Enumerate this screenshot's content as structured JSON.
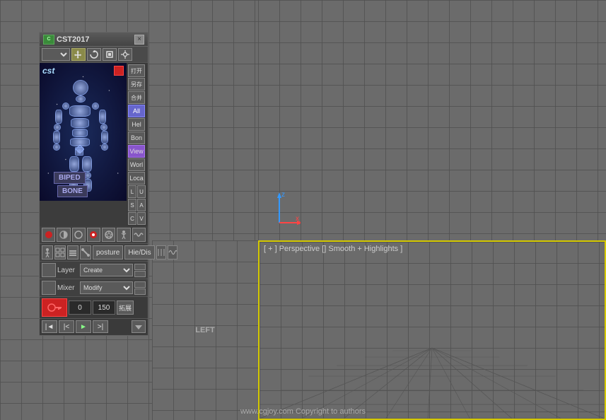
{
  "app": {
    "title": "CST2017",
    "copyright": "www.cgjoy.com  Copyright to authors"
  },
  "panel": {
    "title": "CST2017",
    "close_label": "×",
    "toolbar": {
      "dropdown_value": "",
      "buttons": [
        "move",
        "rotate",
        "scale",
        "settings"
      ]
    },
    "right_buttons": [
      {
        "label": "打开",
        "selected": false
      },
      {
        "label": "另存",
        "selected": false
      },
      {
        "label": "合并",
        "selected": false
      },
      {
        "label": "All",
        "selected": true
      },
      {
        "label": "Hel",
        "selected": false
      },
      {
        "label": "Bon",
        "selected": false
      },
      {
        "label": "View",
        "selected": true,
        "highlighted": true
      },
      {
        "label": "Worl",
        "selected": false
      },
      {
        "label": "Loca",
        "selected": false
      },
      {
        "label": "L",
        "selected": false
      },
      {
        "label": "U",
        "selected": false
      },
      {
        "label": "S",
        "selected": false
      },
      {
        "label": "A",
        "selected": false
      },
      {
        "label": "C",
        "selected": false
      },
      {
        "label": "V",
        "selected": false
      }
    ],
    "biped_label": "BIPED",
    "bone_label": "BONE",
    "ctrl_buttons": [
      "●",
      "◐",
      "◑",
      "◒",
      "☆"
    ],
    "posture_btn": "posture",
    "hie_dis_btn": "Hie/Dis",
    "layer_label": "Layer",
    "layer_create": "Create",
    "mixer_label": "Mixer",
    "mixer_modify": "Modify",
    "key_frame_value": "0",
    "frame_end_value": "150",
    "expand_label": "拓展",
    "playback_controls": [
      "|◄",
      "|<",
      "►",
      ">|"
    ],
    "key_icon": "🔑"
  },
  "viewports": {
    "top_right_label": "",
    "bottom_right_label": "[ + ] Perspective [] Smooth + Highlights ]",
    "bottom_left_label": "LEFT"
  },
  "colors": {
    "bg": "#6b6b6b",
    "grid": "#595959",
    "panel_bg": "#3c3c3c",
    "accent_yellow": "#d4c800",
    "button_active": "#5566bb",
    "button_view_highlight": "#8855aa"
  }
}
